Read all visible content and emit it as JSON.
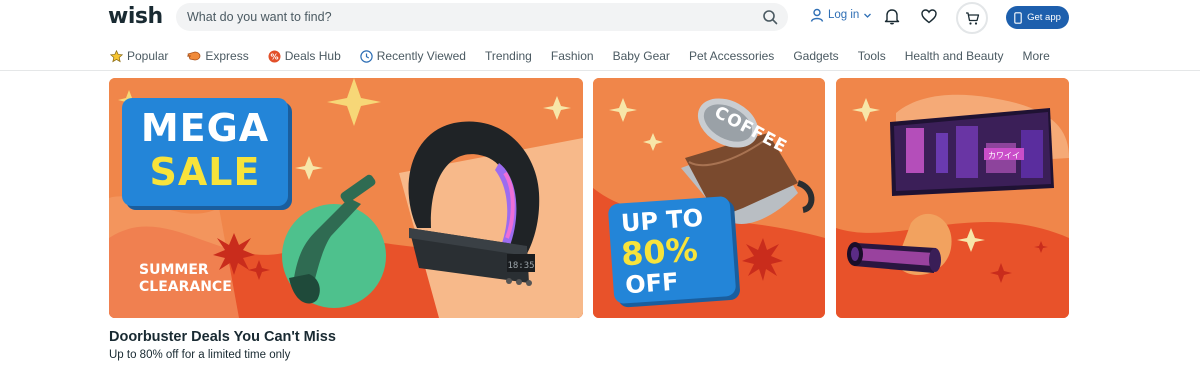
{
  "header": {
    "logo": "wish",
    "search_placeholder": "What do you want to find?",
    "login_label": "Log in",
    "get_app_label": "Get app"
  },
  "categories": [
    {
      "label": "Popular",
      "icon": "star-icon"
    },
    {
      "label": "Express",
      "icon": "express-icon"
    },
    {
      "label": "Deals Hub",
      "icon": "deals-icon"
    },
    {
      "label": "Recently Viewed",
      "icon": "clock-icon"
    },
    {
      "label": "Trending"
    },
    {
      "label": "Fashion"
    },
    {
      "label": "Baby Gear"
    },
    {
      "label": "Pet Accessories"
    },
    {
      "label": "Gadgets"
    },
    {
      "label": "Tools"
    },
    {
      "label": "Health and Beauty"
    },
    {
      "label": "More"
    }
  ],
  "banners": {
    "mega": {
      "line1": "MEGA",
      "line2": "SALE",
      "sub1": "SUMMER",
      "sub2": "CLEARANCE",
      "clock": "18:35"
    },
    "coffee": {
      "label": "COFFEE",
      "promo1": "UP TO",
      "promo2": "80%",
      "promo3": "OFF"
    },
    "desk": {
      "sign": "カワイイ"
    }
  },
  "section": {
    "title": "Doorbuster Deals You Can't Miss",
    "subtitle": "Up to 80% off for a limited time only"
  },
  "colors": {
    "accent_blue": "#1d5fad",
    "banner_orange": "#f0864a",
    "banner_red": "#e8522a",
    "promo_blue": "#2385d8",
    "promo_yellow": "#f7e33b"
  }
}
